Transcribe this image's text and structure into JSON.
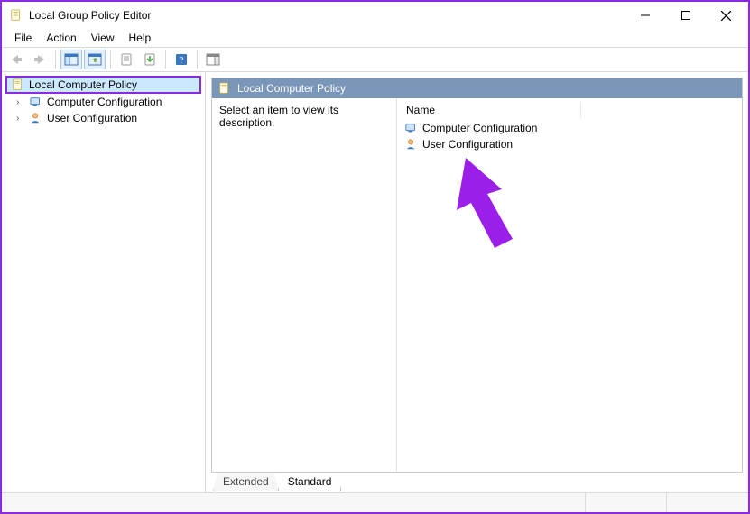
{
  "window": {
    "title": "Local Group Policy Editor"
  },
  "menubar": {
    "items": [
      "File",
      "Action",
      "View",
      "Help"
    ]
  },
  "toolbar": {
    "buttons": [
      {
        "name": "back-icon"
      },
      {
        "name": "forward-icon"
      },
      {
        "name": "up-level-icon"
      },
      {
        "name": "show-hide-tree-icon"
      },
      {
        "name": "properties-icon"
      },
      {
        "name": "refresh-icon"
      },
      {
        "name": "help-icon"
      },
      {
        "name": "show-hide-action-pane-icon"
      }
    ]
  },
  "tree": {
    "root": {
      "label": "Local Computer Policy"
    },
    "children": [
      {
        "label": "Computer Configuration"
      },
      {
        "label": "User Configuration"
      }
    ]
  },
  "content": {
    "header_title": "Local Computer Policy",
    "description_prompt": "Select an item to view its description.",
    "columns": {
      "name": "Name"
    },
    "items": [
      {
        "label": "Computer Configuration"
      },
      {
        "label": "User Configuration"
      }
    ]
  },
  "tabs": {
    "extended": "Extended",
    "standard": "Standard"
  },
  "colors": {
    "highlight_border": "#8a2be2",
    "header_bg": "#7a96b8"
  }
}
